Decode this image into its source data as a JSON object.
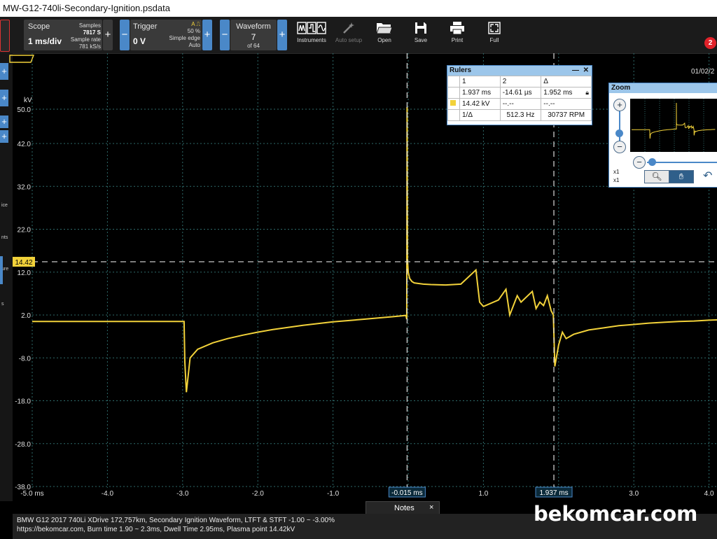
{
  "window": {
    "title": "MW-G12-740li-Secondary-Ignition.psdata"
  },
  "toolbar": {
    "scope": {
      "label": "Scope",
      "value": "1 ms/div"
    },
    "samples": {
      "label": "Samples",
      "value": "7817 S",
      "rate_label": "Sample rate",
      "rate_value": "781 kS/s"
    },
    "trigger": {
      "label": "Trigger",
      "value": "0 V",
      "channel": "A",
      "percent": "50 %",
      "type": "Simple edge",
      "mode": "Auto"
    },
    "waveform": {
      "label": "Waveform",
      "value": "7",
      "of": "of 64"
    },
    "tools": [
      "Instruments",
      "Auto setup",
      "Open",
      "Save",
      "Print",
      "Full"
    ],
    "plus": "+",
    "minus": "−"
  },
  "notification_count": "2",
  "left_fragments": [
    "ice",
    "nts",
    "ure",
    "s"
  ],
  "plot": {
    "y_unit": "kV",
    "y_ticks": [
      "50.0",
      "42.0",
      "32.0",
      "22.0",
      "12.0",
      "2.0",
      "-8.0",
      "-18.0",
      "-28.0",
      "-38.0"
    ],
    "x_ticks": [
      "-5.0 ms",
      "-4.0",
      "-3.0",
      "-2.0",
      "-1.0",
      "0.0",
      "1.0",
      "2.0",
      "3.0",
      "4.0"
    ],
    "ruler_level": "14.42",
    "ruler1_label": "-0.015 ms",
    "ruler2_label": "1.937 ms",
    "date": "01/02/2",
    "trace_color": "#f2d23a"
  },
  "chart_data": {
    "type": "line",
    "title": "",
    "xlabel": "",
    "ylabel": "kV",
    "xlim": [
      -5.0,
      4.5
    ],
    "ylim": [
      -38.0,
      50.0
    ],
    "grid": true,
    "series": [
      {
        "values_x": [
          -5.0,
          -2.98,
          -2.97,
          -2.95,
          -2.9,
          -2.8,
          -2.6,
          -2.4,
          -2.2,
          -2.0,
          -1.8,
          -1.6,
          -1.4,
          -1.2,
          -1.0,
          -0.8,
          -0.6,
          -0.4,
          -0.2,
          -0.03,
          -0.02,
          -0.015,
          -0.01,
          0.0,
          0.02,
          0.05,
          0.08,
          0.12,
          0.2,
          0.3,
          0.5,
          0.7,
          0.9,
          0.95,
          1.0,
          1.2,
          1.3,
          1.35,
          1.45,
          1.5,
          1.65,
          1.7,
          1.75,
          1.8,
          1.85,
          1.9,
          1.93,
          1.95,
          2.0,
          2.05,
          2.1,
          2.2,
          2.4,
          2.6,
          2.8,
          3.0,
          3.2,
          3.4,
          3.6,
          3.8,
          4.0,
          4.3
        ],
        "values_y": [
          0.5,
          0.5,
          -9.0,
          -16.0,
          -8.0,
          -6.0,
          -4.5,
          -3.5,
          -2.7,
          -2.0,
          -1.4,
          -0.9,
          -0.4,
          0.0,
          0.4,
          0.7,
          1.0,
          1.3,
          1.6,
          1.9,
          1.0,
          55.0,
          15.0,
          12.0,
          10.5,
          9.8,
          9.5,
          9.4,
          9.2,
          9.1,
          9.0,
          9.2,
          12.5,
          5.0,
          4.0,
          5.5,
          8.0,
          2.0,
          6.5,
          5.0,
          7.5,
          3.5,
          5.0,
          4.2,
          6.5,
          3.0,
          2.0,
          -10.0,
          -5.0,
          -2.0,
          -3.5,
          -2.5,
          -1.5,
          -1.0,
          -0.5,
          -0.2,
          0.1,
          0.3,
          0.5,
          0.6,
          0.8,
          1.0
        ]
      }
    ]
  },
  "rulers_panel": {
    "title": "Rulers",
    "col1": "1",
    "col2": "2",
    "col3": "Δ",
    "t1": "1.937 ms",
    "t2": "-14.61 µs",
    "dt": "1.952 ms",
    "v1": "14.42 kV",
    "v2": "--.--",
    "dv": "--.--",
    "inv": "1/Δ",
    "freq": "512.3 Hz",
    "rpm": "30737 RPM"
  },
  "zoom_panel": {
    "title": "Zoom",
    "x1a": "x1",
    "x1b": "x1"
  },
  "notes": {
    "label": "Notes",
    "close": "×"
  },
  "caption": {
    "line1": "BMW G12 2017 740Li XDrive 172,757km, Secondary Ignition Waveform, LTFT & STFT -1.00 ~ -3.00%",
    "line2": "https://bekomcar.com, Burn time 1.90 ~ 2.3ms, Dwell Time 2.95ms, Plasma point 14.42kV"
  },
  "watermark": "bekomcar.com"
}
